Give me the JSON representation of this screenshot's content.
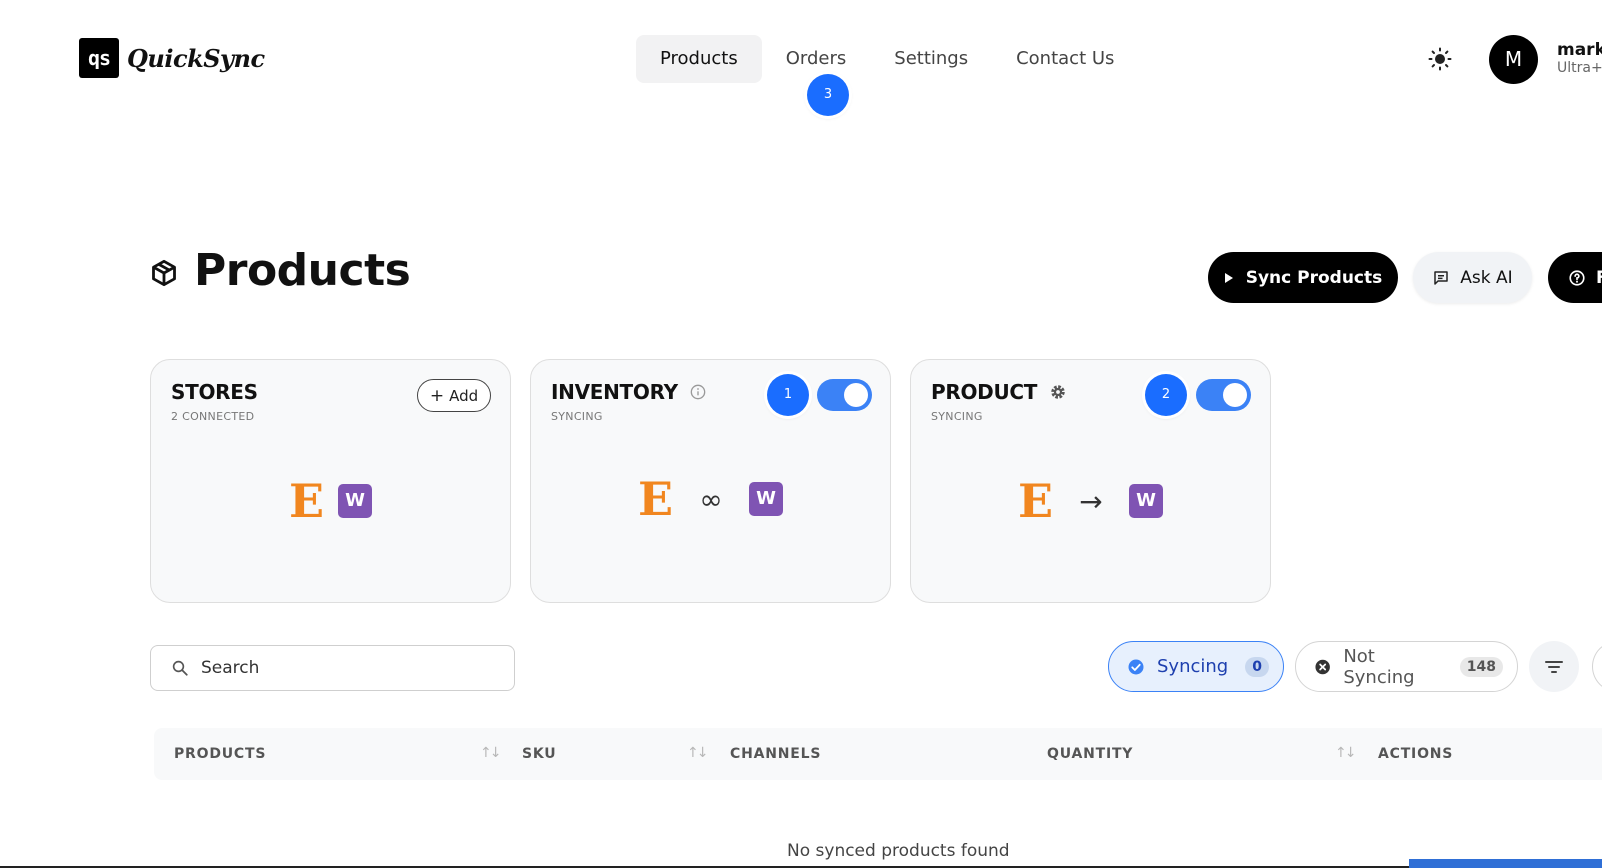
{
  "header": {
    "logo_mark": "qs",
    "logo_text": "QuickSync",
    "nav": [
      {
        "label": "Products",
        "active": true
      },
      {
        "label": "Orders",
        "active": false
      },
      {
        "label": "Settings",
        "active": false
      },
      {
        "label": "Contact Us",
        "active": false
      }
    ],
    "user": {
      "initial": "M",
      "name": "mark",
      "plan": "Ultra+"
    }
  },
  "badges": {
    "orders": "3",
    "inventory": "1",
    "product": "2"
  },
  "page": {
    "title": "Products",
    "icon": "cube-icon"
  },
  "actions": {
    "sync_label": "Sync Products",
    "ask_label": "Ask AI",
    "help_label": "F"
  },
  "cards": {
    "stores": {
      "title": "STORES",
      "subtitle": "2 CONNECTED",
      "add_label": "Add"
    },
    "inventory": {
      "title": "INVENTORY",
      "subtitle": "SYNCING",
      "enabled": true
    },
    "product": {
      "title": "PRODUCT",
      "subtitle": "SYNCING",
      "enabled": true
    },
    "etsy_letter": "E",
    "woo_letter": "W",
    "infinity": "∞",
    "arrow": "→"
  },
  "search": {
    "placeholder": "Search"
  },
  "filters": {
    "syncing": {
      "label": "Syncing",
      "count": "0"
    },
    "not_syncing": {
      "label": "Not Syncing",
      "count": "148"
    }
  },
  "table": {
    "columns": [
      "PRODUCTS",
      "SKU",
      "CHANNELS",
      "QUANTITY",
      "ACTIONS"
    ],
    "empty_message": "No synced products found"
  },
  "colors": {
    "accent": "#1a6dff",
    "toggle": "#3b82f6",
    "etsy": "#f1861f",
    "woo": "#7f54b3"
  }
}
